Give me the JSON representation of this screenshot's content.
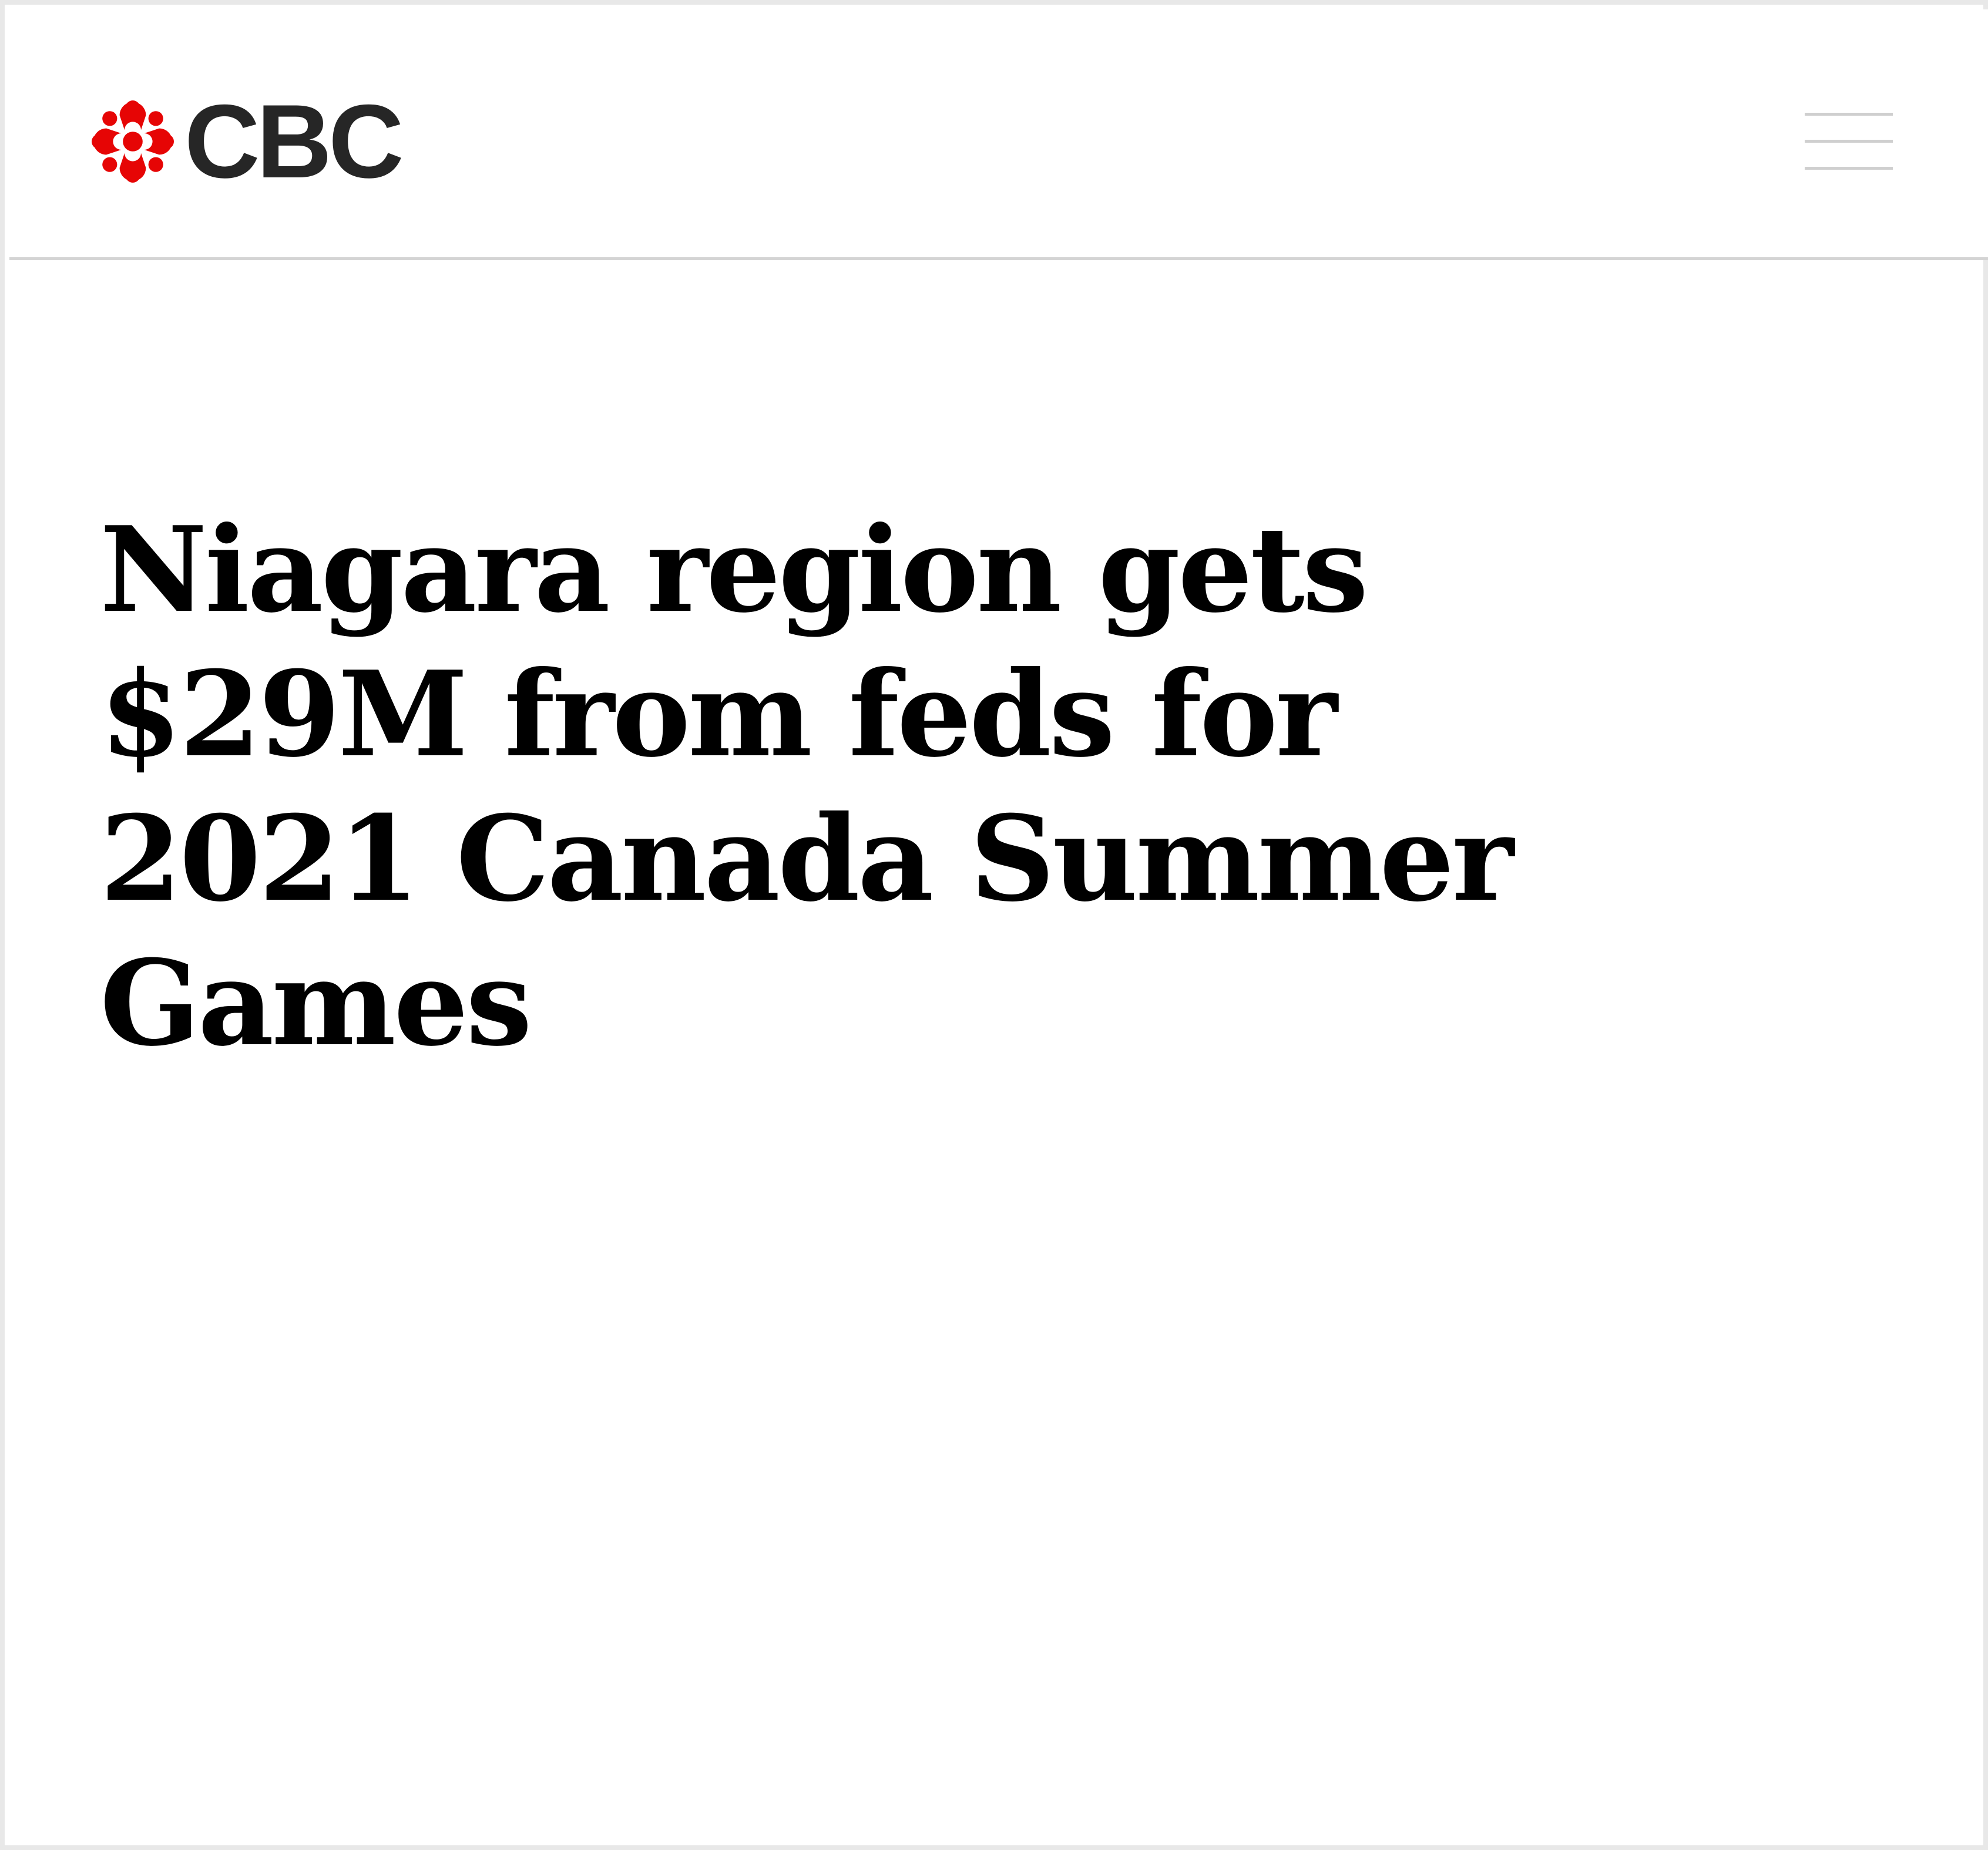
{
  "header": {
    "logo": {
      "wordmark": "CBC",
      "icon": "cbc-gem-icon",
      "brand_color": "#e60505",
      "text_color": "#262626"
    },
    "menu": {
      "icon": "hamburger-menu-icon"
    }
  },
  "article": {
    "headline": "Niagara region gets $29M from feds for 2021 Canada Summer Games"
  }
}
